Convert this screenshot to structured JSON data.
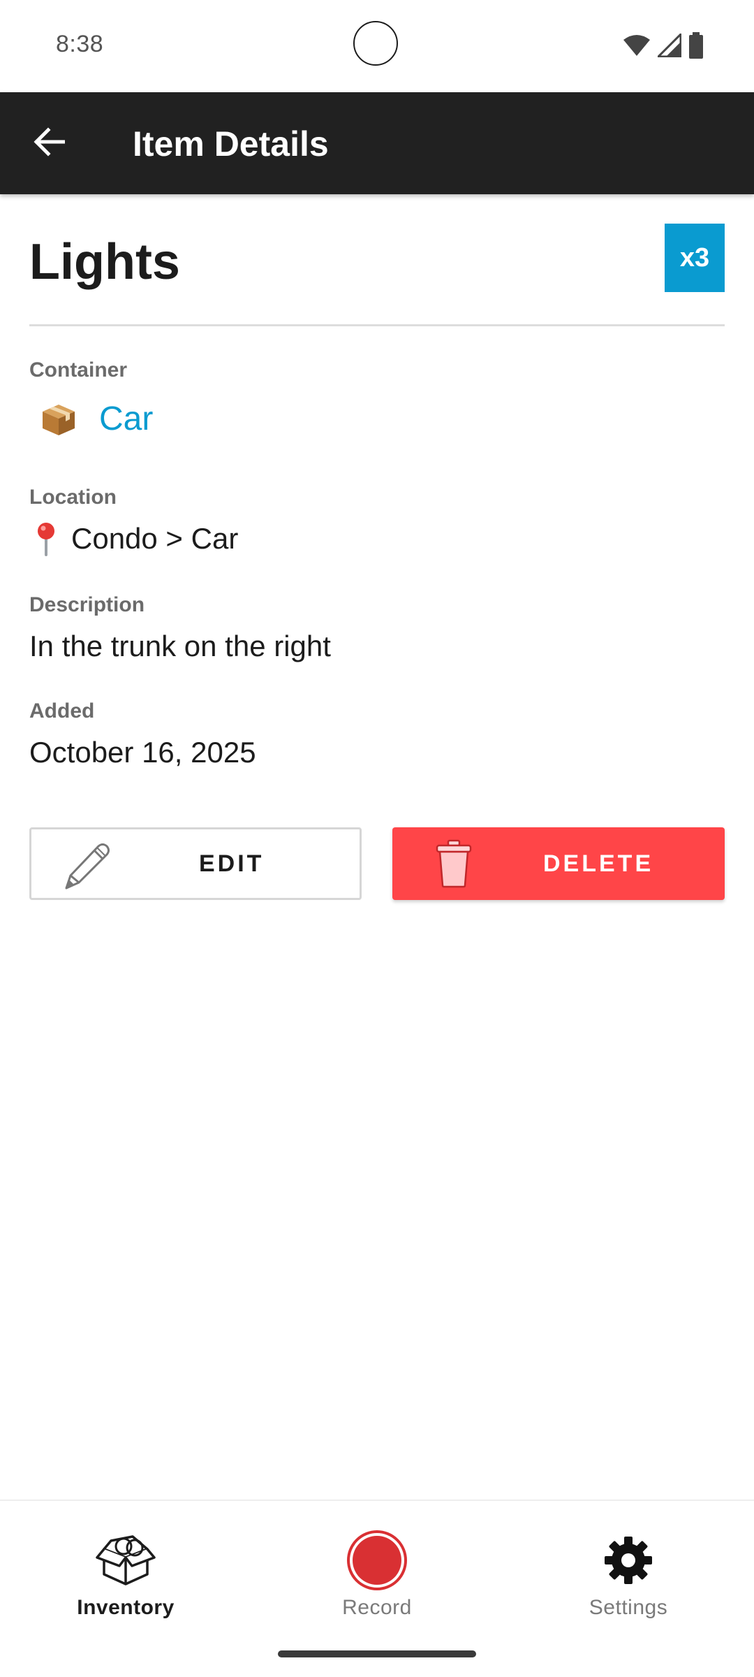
{
  "status_bar": {
    "time": "8:38",
    "icons": [
      "wifi-icon",
      "signal-icon",
      "battery-icon"
    ]
  },
  "app_bar": {
    "title": "Item Details",
    "back_icon": "arrow-left-icon"
  },
  "item": {
    "name": "Lights",
    "quantity_badge": "x3"
  },
  "fields": {
    "container": {
      "label": "Container",
      "icon": "package-box-icon",
      "value": "Car"
    },
    "location": {
      "label": "Location",
      "icon": "map-pin-icon",
      "value": "Condo > Car"
    },
    "description": {
      "label": "Description",
      "value": "In the trunk on the right"
    },
    "added": {
      "label": "Added",
      "value": "October 16, 2025"
    }
  },
  "actions": {
    "edit_label": "EDIT",
    "edit_icon": "pencil-icon",
    "delete_label": "DELETE",
    "delete_icon": "trash-can-icon"
  },
  "bottom_nav": {
    "items": [
      {
        "label": "Inventory",
        "icon": "open-box-icon",
        "active": true
      },
      {
        "label": "Record",
        "icon": "record-icon",
        "active": false
      },
      {
        "label": "Settings",
        "icon": "gear-icon",
        "active": false
      }
    ]
  },
  "colors": {
    "app_bar": "#212121",
    "accent": "#0a9bd0",
    "delete": "#ff4548",
    "record": "#d93033"
  }
}
